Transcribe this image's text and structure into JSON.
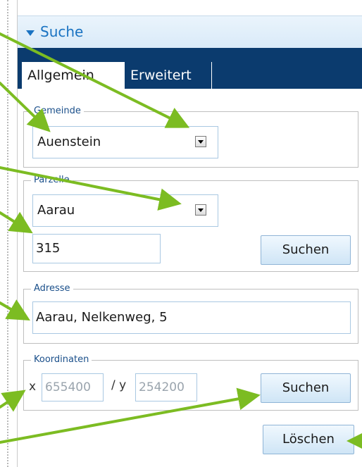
{
  "panel": {
    "title": "Suche"
  },
  "tabs": [
    {
      "label": "Allgemein"
    },
    {
      "label": "Erweitert"
    }
  ],
  "gemeinde": {
    "legend": "Gemeinde",
    "selected": "Auenstein"
  },
  "parzelle": {
    "legend": "Parzelle",
    "selected": "Aarau",
    "number": "315",
    "search_label": "Suchen"
  },
  "adresse": {
    "legend": "Adresse",
    "value": "Aarau, Nelkenweg, 5"
  },
  "koordinaten": {
    "legend": "Koordinaten",
    "x_label": "x",
    "x_value": "655400",
    "separator": "/ y",
    "y_value": "254200",
    "search_label": "Suchen"
  },
  "actions": {
    "clear_label": "Löschen"
  },
  "colors": {
    "accent": "#1a73c2",
    "tabbar": "#0b3b6e",
    "annotation_arrow": "#7cbc22"
  }
}
